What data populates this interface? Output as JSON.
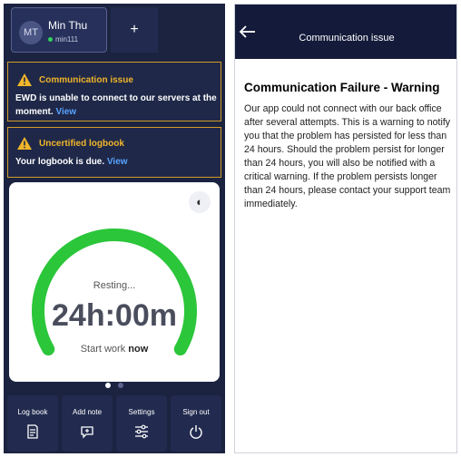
{
  "left": {
    "user": {
      "initials": "MT",
      "name": "Min Thu",
      "id": "min111"
    },
    "add_tab_label": "+",
    "alerts": [
      {
        "title": "Communication issue",
        "message": "EWD is unable to connect to our servers at the moment.",
        "link": "View"
      },
      {
        "title": "Uncertified logbook",
        "message": "Your logbook is due.",
        "link": "View"
      }
    ],
    "dial": {
      "status": "Resting...",
      "time": "24h:00m",
      "start_prefix": "Start work",
      "start_now": "now",
      "progress": 1.0,
      "progress_color": "#2bc63a",
      "track_color": "#e6e8ee"
    },
    "page_dots": {
      "count": 2,
      "active_index": 0
    },
    "nav": [
      {
        "label": "Log book",
        "icon": "logbook-icon"
      },
      {
        "label": "Add note",
        "icon": "add-note-icon"
      },
      {
        "label": "Settings",
        "icon": "settings-icon"
      },
      {
        "label": "Sign out",
        "icon": "power-icon"
      }
    ],
    "colors": {
      "background": "#1b2340",
      "warning": "#f1b52a",
      "link": "#58a4ff"
    }
  },
  "right": {
    "header_title": "Communication issue",
    "message_title": "Communication Failure - Warning",
    "message_body": "Our app could not connect with our back office after several attempts. This is a warning to notify you that the problem has persisted for less than 24 hours. Should the problem persist for longer than 24 hours, you will also be notified with a critical warning. If the problem persists longer than 24 hours, please contact your support team immediately.",
    "colors": {
      "header": "#141b3a"
    }
  }
}
